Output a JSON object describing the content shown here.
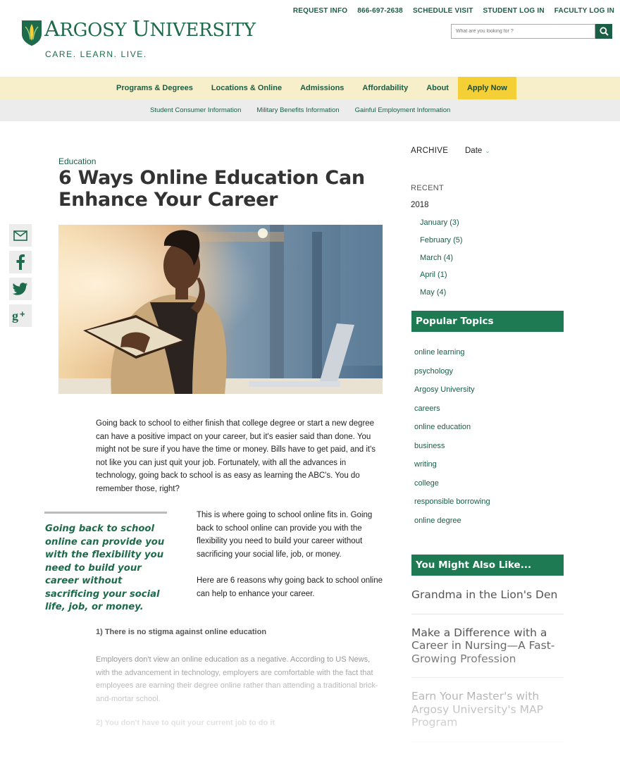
{
  "utility_nav": [
    "REQUEST INFO",
    "866-697-2638",
    "SCHEDULE VISIT",
    "STUDENT LOG IN",
    "FACULTY LOG IN"
  ],
  "logo": {
    "name_a": "A",
    "name_b": "RGOSY ",
    "name_c": "U",
    "name_d": "NIVERSITY",
    "tagline": "CARE. LEARN. LIVE."
  },
  "search": {
    "placeholder": "What are you looking for ?",
    "icon": "search-icon"
  },
  "main_nav": {
    "items": [
      "Programs & Degrees",
      "Locations & Online",
      "Admissions",
      "Affordability",
      "About"
    ],
    "cta": "Apply Now"
  },
  "sub_nav": [
    "Student Consumer Information",
    "Military Benefits Information",
    "Gainful Employment Information"
  ],
  "social": [
    "email-icon",
    "facebook-icon",
    "twitter-icon",
    "google-plus-icon"
  ],
  "article": {
    "category": "Education",
    "title": "6 Ways Online Education Can Enhance Your Career",
    "p1": "Going back to school to either finish that college degree or start a new degree can have a positive impact on your career, but it's easier said than done. You might not be sure if you have the time or money. Bills have to get paid, and it's not like you can just quit your job. Fortunately, with all the advances in technology, going back to school is as easy as learning the ABC's. You do remember those, right?",
    "pull_quote": "Going back to school online can provide you with the flexibility you need to build your career without sacrificing your social life, job, or money.",
    "p2": "This is where going to school online fits in. Going back to school online can provide you with the flexibility you need to build your career without sacrificing your social life, job, or money.",
    "p3": "Here are 6 reasons why going back to school online can help to enhance your career.",
    "h1": "1) There is no stigma against online education",
    "p4": "Employers don't view an online education as a negative. According to US News, with the advancement in technology, employers are comfortable with the fact that employees are earning their degree online rather than attending a traditional brick-and-mortar school.",
    "h2": "2) You don't have to quit your current job to do it"
  },
  "sidebar": {
    "archive": "ARCHIVE",
    "date": "Date",
    "recent": "RECENT",
    "year": "2018",
    "months": [
      "January (3)",
      "February (5)",
      "March (4)",
      "April (1)",
      "May (4)"
    ],
    "popular_title": "Popular Topics",
    "topics": [
      "online learning",
      "psychology",
      "Argosy University",
      "careers",
      "online education",
      "business",
      "writing",
      "college",
      "responsible borrowing",
      "online degree"
    ],
    "also_title": "You Might Also Like...",
    "also": [
      "Grandma in the Lion's Den",
      "Make a Difference with a Career in Nursing—A Fast-Growing Profession",
      "Earn Your Master's with Argosy University's MAP Program"
    ]
  },
  "colors": {
    "brand_green": "#1e6b4b",
    "nav_bg": "#f6efc9",
    "apply_bg": "#f5cf36",
    "box_green": "#1e7a52"
  }
}
